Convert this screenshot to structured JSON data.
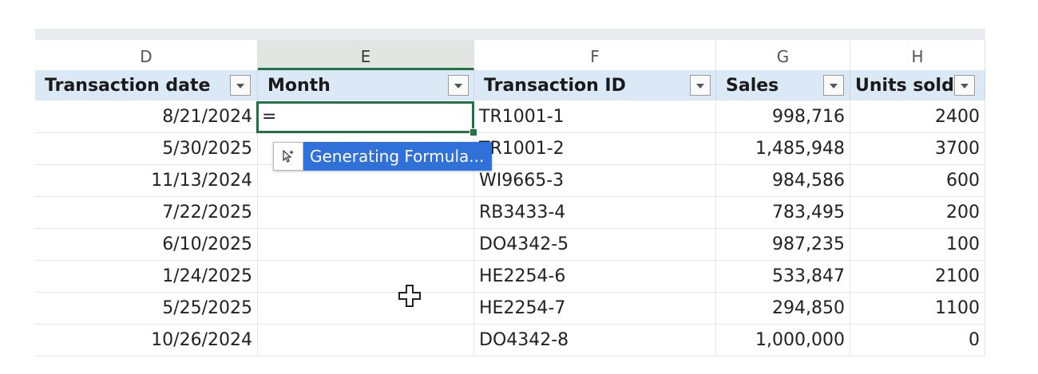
{
  "columns": [
    {
      "letter": "D",
      "header": "Transaction date"
    },
    {
      "letter": "E",
      "header": "Month"
    },
    {
      "letter": "F",
      "header": "Transaction ID"
    },
    {
      "letter": "G",
      "header": "Sales"
    },
    {
      "letter": "H",
      "header": "Units sold"
    }
  ],
  "active_cell": {
    "column": "E",
    "value": "="
  },
  "generating_popup": {
    "label": "Generating Formula...",
    "icon": "sparkle-pointer-icon"
  },
  "rows": [
    {
      "date": "8/21/2024",
      "id": "TR1001-1",
      "sales": "998,716",
      "units": "2400"
    },
    {
      "date": "5/30/2025",
      "id": "TR1001-2",
      "sales": "1,485,948",
      "units": "3700"
    },
    {
      "date": "11/13/2024",
      "id": "WI9665-3",
      "sales": "984,586",
      "units": "600"
    },
    {
      "date": "7/22/2025",
      "id": "RB3433-4",
      "sales": "783,495",
      "units": "200"
    },
    {
      "date": "6/10/2025",
      "id": "DO4342-5",
      "sales": "987,235",
      "units": "100"
    },
    {
      "date": "1/24/2025",
      "id": "HE2254-6",
      "sales": "533,847",
      "units": "2100"
    },
    {
      "date": "5/25/2025",
      "id": "HE2254-7",
      "sales": "294,850",
      "units": "1100"
    },
    {
      "date": "10/26/2024",
      "id": "DO4342-8",
      "sales": "1,000,000",
      "units": "0"
    }
  ],
  "colors": {
    "accent": "#217346",
    "header_bg": "#dbe9f7",
    "popup": "#2f71d9"
  }
}
